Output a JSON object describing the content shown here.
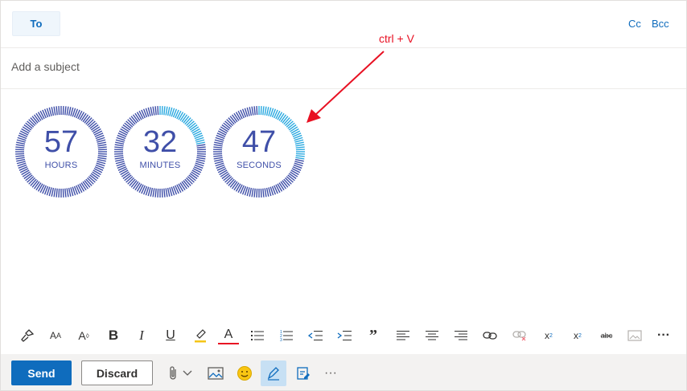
{
  "header": {
    "to_label": "To",
    "cc_label": "Cc",
    "bcc_label": "Bcc"
  },
  "subject": {
    "placeholder": "Add a subject",
    "value": ""
  },
  "annotation": {
    "text": "ctrl + V",
    "color": "#e81123"
  },
  "body": {
    "countdown": [
      {
        "value": "57",
        "unit": "HOURS"
      },
      {
        "value": "32",
        "unit": "MINUTES"
      },
      {
        "value": "47",
        "unit": "SECONDS"
      }
    ],
    "colors": {
      "text": "#3f4fa8",
      "ring_dark": "#3f4fa8",
      "ring_light": "#2aa9e0"
    }
  },
  "format_toolbar": {
    "tools": [
      {
        "icon": "format-painter-icon"
      },
      {
        "icon": "font-icon"
      },
      {
        "icon": "font-size-icon"
      },
      {
        "icon": "bold-icon",
        "glyph": "B"
      },
      {
        "icon": "italic-icon",
        "glyph": "I"
      },
      {
        "icon": "underline-icon",
        "glyph": "U"
      },
      {
        "icon": "highlight-icon"
      },
      {
        "icon": "font-color-icon",
        "glyph": "A"
      },
      {
        "icon": "bullets-icon"
      },
      {
        "icon": "numbering-icon"
      },
      {
        "icon": "decrease-indent-icon"
      },
      {
        "icon": "increase-indent-icon"
      },
      {
        "icon": "quote-icon"
      },
      {
        "icon": "align-left-icon"
      },
      {
        "icon": "align-center-icon"
      },
      {
        "icon": "align-right-icon"
      },
      {
        "icon": "insert-link-icon"
      },
      {
        "icon": "remove-link-icon"
      },
      {
        "icon": "superscript-icon"
      },
      {
        "icon": "subscript-icon"
      },
      {
        "icon": "strikethrough-icon",
        "glyph": "abc"
      },
      {
        "icon": "insert-image-icon"
      },
      {
        "icon": "more-options-icon",
        "glyph": "···"
      }
    ]
  },
  "actions": {
    "send_label": "Send",
    "discard_label": "Discard",
    "send_color": "#0f6cbd"
  }
}
